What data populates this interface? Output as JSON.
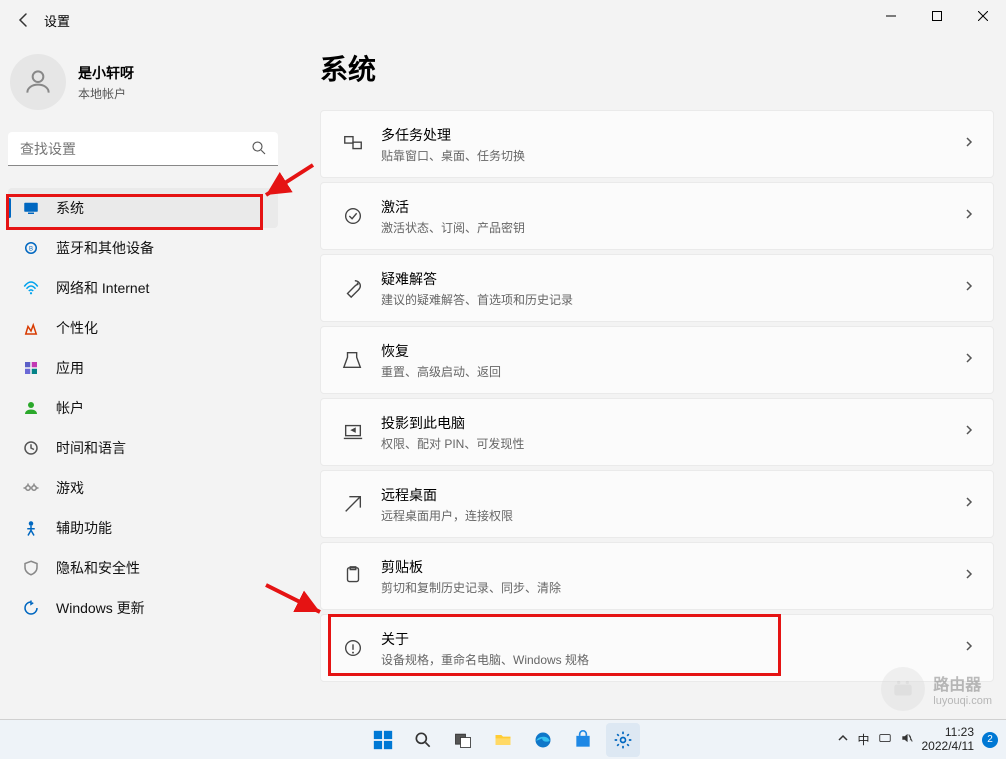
{
  "window": {
    "app_title": "设置"
  },
  "user": {
    "name": "是小轩呀",
    "subtitle": "本地帐户"
  },
  "search": {
    "placeholder": "查找设置"
  },
  "nav": [
    {
      "label": "系统",
      "icon_color": "#0067c0",
      "selected": true,
      "name": "sidebar-item-system"
    },
    {
      "label": "蓝牙和其他设备",
      "icon_color": "#0067c0",
      "selected": false,
      "name": "sidebar-item-bluetooth"
    },
    {
      "label": "网络和 Internet",
      "icon_color": "#00a2ed",
      "selected": false,
      "name": "sidebar-item-network"
    },
    {
      "label": "个性化",
      "icon_color": "#d83b01",
      "selected": false,
      "name": "sidebar-item-personalization"
    },
    {
      "label": "应用",
      "icon_color": "#5b5fc7",
      "selected": false,
      "name": "sidebar-item-apps"
    },
    {
      "label": "帐户",
      "icon_color": "#2aa82a",
      "selected": false,
      "name": "sidebar-item-accounts"
    },
    {
      "label": "时间和语言",
      "icon_color": "#555555",
      "selected": false,
      "name": "sidebar-item-time-language"
    },
    {
      "label": "游戏",
      "icon_color": "#888888",
      "selected": false,
      "name": "sidebar-item-gaming"
    },
    {
      "label": "辅助功能",
      "icon_color": "#0067c0",
      "selected": false,
      "name": "sidebar-item-accessibility"
    },
    {
      "label": "隐私和安全性",
      "icon_color": "#888888",
      "selected": false,
      "name": "sidebar-item-privacy"
    },
    {
      "label": "Windows 更新",
      "icon_color": "#0067c0",
      "selected": false,
      "name": "sidebar-item-windows-update"
    }
  ],
  "page": {
    "title": "系统"
  },
  "settings": [
    {
      "title": "多任务处理",
      "sub": "贴靠窗口、桌面、任务切换",
      "name": "setting-multitasking"
    },
    {
      "title": "激活",
      "sub": "激活状态、订阅、产品密钥",
      "name": "setting-activation"
    },
    {
      "title": "疑难解答",
      "sub": "建议的疑难解答、首选项和历史记录",
      "name": "setting-troubleshoot"
    },
    {
      "title": "恢复",
      "sub": "重置、高级启动、返回",
      "name": "setting-recovery"
    },
    {
      "title": "投影到此电脑",
      "sub": "权限、配对 PIN、可发现性",
      "name": "setting-projecting"
    },
    {
      "title": "远程桌面",
      "sub": "远程桌面用户，连接权限",
      "name": "setting-remote-desktop"
    },
    {
      "title": "剪贴板",
      "sub": "剪切和复制历史记录、同步、清除",
      "name": "setting-clipboard"
    },
    {
      "title": "关于",
      "sub": "设备规格，重命名电脑、Windows 规格",
      "name": "setting-about"
    }
  ],
  "taskbar": {
    "ime": "中",
    "time": "11:23",
    "date": "2022/4/11",
    "notification_count": "2"
  },
  "watermark": {
    "line1": "路由器",
    "line2": "luyouqi.com"
  }
}
